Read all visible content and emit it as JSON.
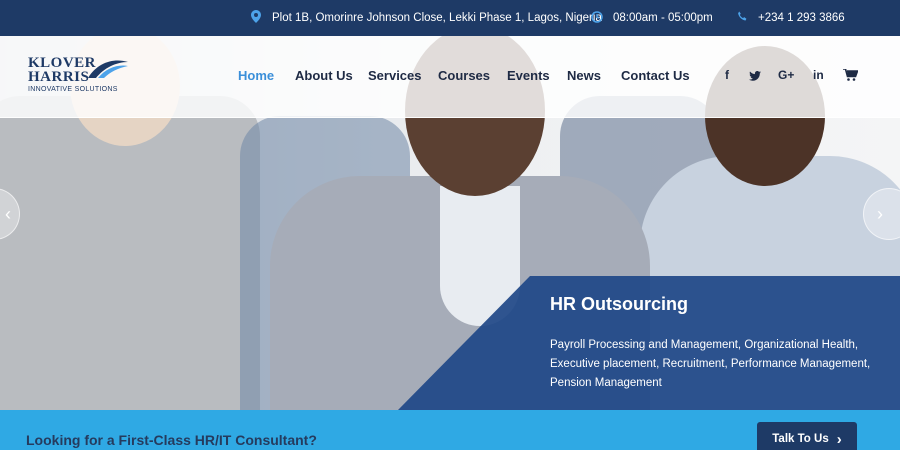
{
  "topbar": {
    "address": "Plot 1B, Omorinre Johnson Close, Lekki Phase 1, Lagos, Nigeria",
    "hours": "08:00am - 05:00pm",
    "phone": "+234 1 293 3866",
    "address_icon": "map-pin-icon",
    "hours_icon": "clock-icon",
    "phone_icon": "phone-icon"
  },
  "logo": {
    "line1": "KLOVER",
    "line2": "HARRIS",
    "tagline": "INNOVATIVE SOLUTIONS"
  },
  "nav": {
    "items": [
      "Home",
      "About Us",
      "Services",
      "Courses",
      "Events",
      "News",
      "Contact Us"
    ],
    "active": "Home"
  },
  "social": {
    "facebook": "f",
    "twitter": "🐦",
    "google": "G+",
    "linkedin": "in",
    "cart": "🛒"
  },
  "slider": {
    "title": "HR Outsourcing",
    "text": "Payroll Processing and Management, Organizational Health, Executive placement, Recruitment, Performance Management, Pension Management",
    "prev": "‹",
    "next": "›"
  },
  "cta": {
    "question": "Looking for a First-Class HR/IT Consultant?",
    "button": "Talk To Us",
    "button_icon": "›"
  },
  "colors": {
    "navy": "#1e3a66",
    "accent_blue": "#4da3ea",
    "cta_band": "#2fa9e4",
    "active_nav": "#3b8fd9"
  }
}
